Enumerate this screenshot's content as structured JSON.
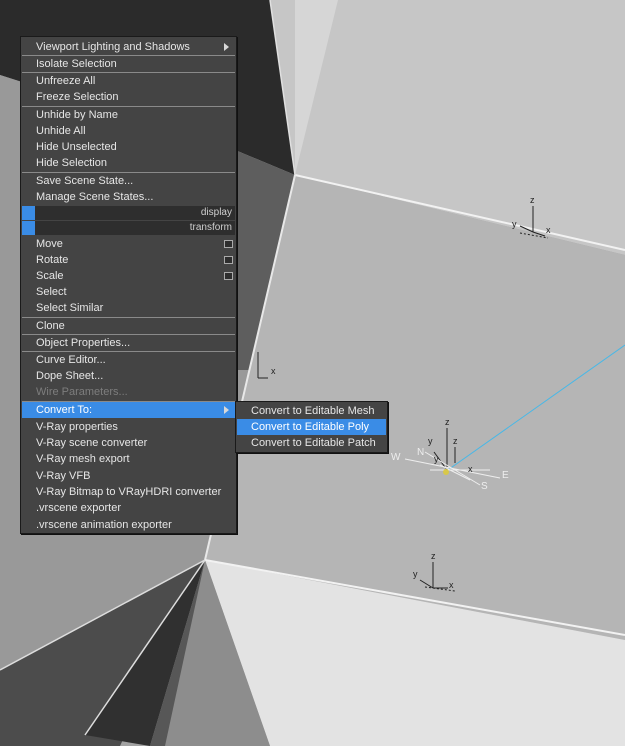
{
  "quad_menu": {
    "groups": [
      [
        "Viewport Lighting and Shadows",
        "Isolate Selection"
      ],
      [
        "Unfreeze All",
        "Freeze Selection"
      ],
      [
        "Unhide by Name",
        "Unhide All",
        "Hide Unselected",
        "Hide Selection"
      ],
      [
        "Save Scene State...",
        "Manage Scene States..."
      ],
      [
        "Move",
        "Rotate",
        "Scale",
        "Select",
        "Select Similar"
      ],
      [
        "Clone"
      ],
      [
        "Object Properties..."
      ],
      [
        "Curve Editor...",
        "Dope Sheet...",
        "Wire Parameters..."
      ],
      [
        "Convert To:",
        "V-Ray properties",
        "V-Ray scene converter",
        "V-Ray mesh export",
        "V-Ray VFB",
        "V-Ray Bitmap to VRayHDRI converter",
        ".vrscene exporter",
        ".vrscene animation exporter"
      ]
    ],
    "quadrant_labels": {
      "top_right": "display",
      "bottom_right": "transform"
    },
    "highlighted_item": "Convert To:",
    "disabled_item": "Wire Parameters..."
  },
  "submenu": {
    "items": [
      "Convert to Editable Mesh",
      "Convert to Editable Poly",
      "Convert to Editable Patch"
    ],
    "highlighted_item": "Convert to Editable Poly"
  },
  "gizmos": {
    "axis_x": "x",
    "axis_y": "y",
    "axis_z": "z",
    "compass_w": "W",
    "compass_n": "N",
    "compass_e": "E",
    "compass_s": "S"
  },
  "colors": {
    "highlight": "#3a8ce6",
    "menu_bg": "#444444",
    "band_bg": "#2e2e2e"
  }
}
